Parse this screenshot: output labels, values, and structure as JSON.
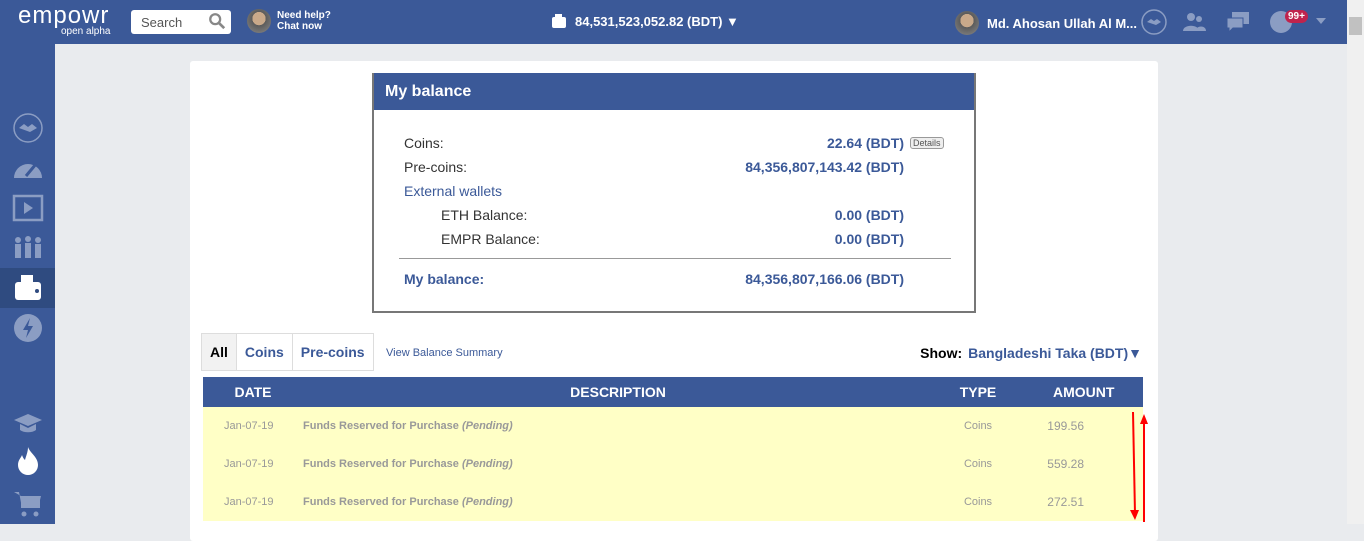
{
  "topbar": {
    "logo": "empowr",
    "logo_sub": "open alpha",
    "search_placeholder": "Search",
    "help_line1": "Need help?",
    "help_line2": "Chat now",
    "balance": "84,531,523,052.82 (BDT) ▼",
    "user_name": "Md. Ahosan Ullah Al M...",
    "notif_badge": "99+"
  },
  "balance_box": {
    "title": "My balance",
    "coins_label": "Coins:",
    "coins_value": "22.64 (BDT)",
    "details_label": "Details",
    "precoins_label": "Pre-coins:",
    "precoins_value": "84,356,807,143.42 (BDT)",
    "external_label": "External wallets",
    "eth_label": "ETH Balance:",
    "eth_value": "0.00 (BDT)",
    "empr_label": "EMPR Balance:",
    "empr_value": "0.00 (BDT)",
    "total_label": "My balance:",
    "total_value": "84,356,807,166.06 (BDT)"
  },
  "filters": {
    "tabs": [
      "All",
      "Coins",
      "Pre-coins"
    ],
    "summary_link": "View Balance Summary",
    "show_label": "Show:",
    "currency": "Bangladeshi Taka (BDT)▼"
  },
  "table": {
    "headers": [
      "DATE",
      "DESCRIPTION",
      "TYPE",
      "AMOUNT"
    ],
    "rows": [
      {
        "date": "Jan-07-19",
        "desc": "Funds Reserved for Purchase ",
        "status": "(Pending)",
        "type": "Coins",
        "amount": "199.56"
      },
      {
        "date": "Jan-07-19",
        "desc": "Funds Reserved for Purchase ",
        "status": "(Pending)",
        "type": "Coins",
        "amount": "559.28"
      },
      {
        "date": "Jan-07-19",
        "desc": "Funds Reserved for Purchase ",
        "status": "(Pending)",
        "type": "Coins",
        "amount": "272.51"
      }
    ]
  },
  "colors": {
    "brand": "#3b5998",
    "row_bg": "#ffffc6",
    "badge": "#c0234d",
    "annotation": "#ff0000"
  }
}
